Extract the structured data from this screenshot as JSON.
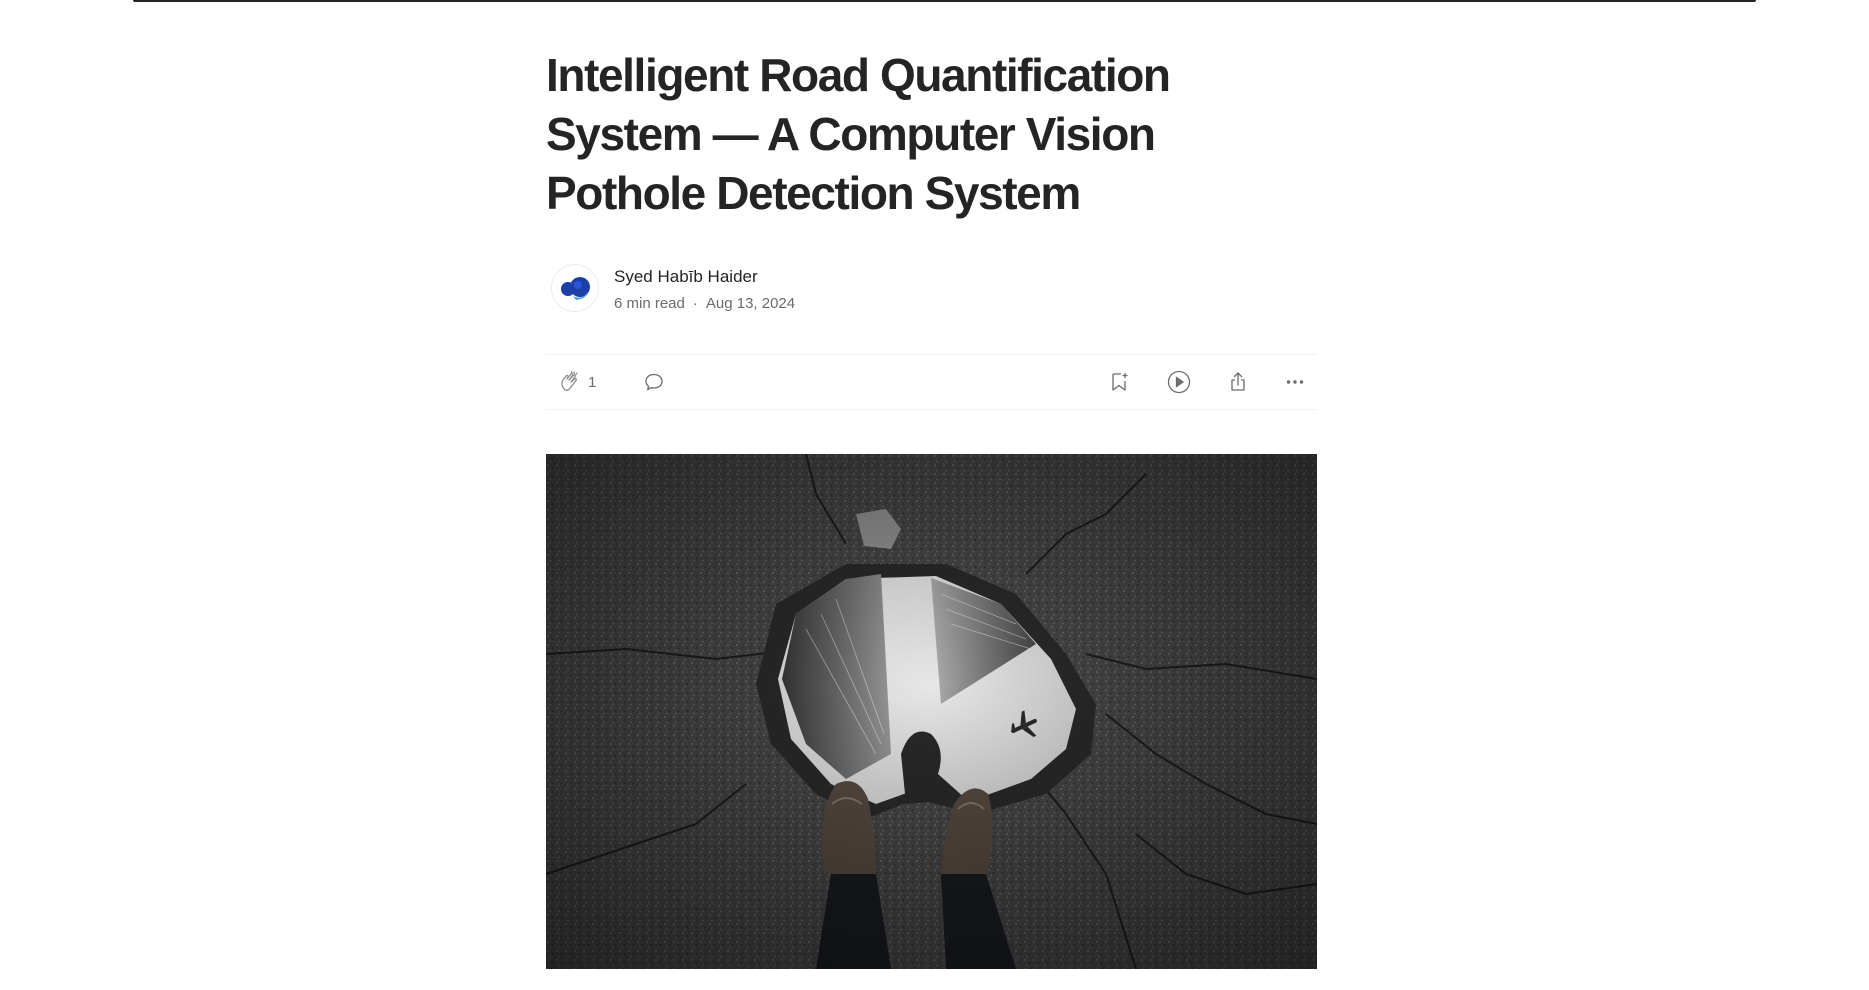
{
  "article": {
    "title": "Intelligent Road Quantification System — A Computer Vision Pothole Detection System",
    "author": "Syed Habīb Haider",
    "read_time": "6 min read",
    "separator": "·",
    "date": "Aug 13, 2024"
  },
  "actions": {
    "clap_count": "1",
    "icons": [
      "clap-icon",
      "comment-icon",
      "bookmark-add-icon",
      "play-icon",
      "share-icon",
      "more-icon"
    ]
  },
  "colors": {
    "text": "#242424",
    "muted": "#6b6b6b",
    "divider": "#f2f2f2",
    "avatar_blue": "#1f3fa8"
  }
}
